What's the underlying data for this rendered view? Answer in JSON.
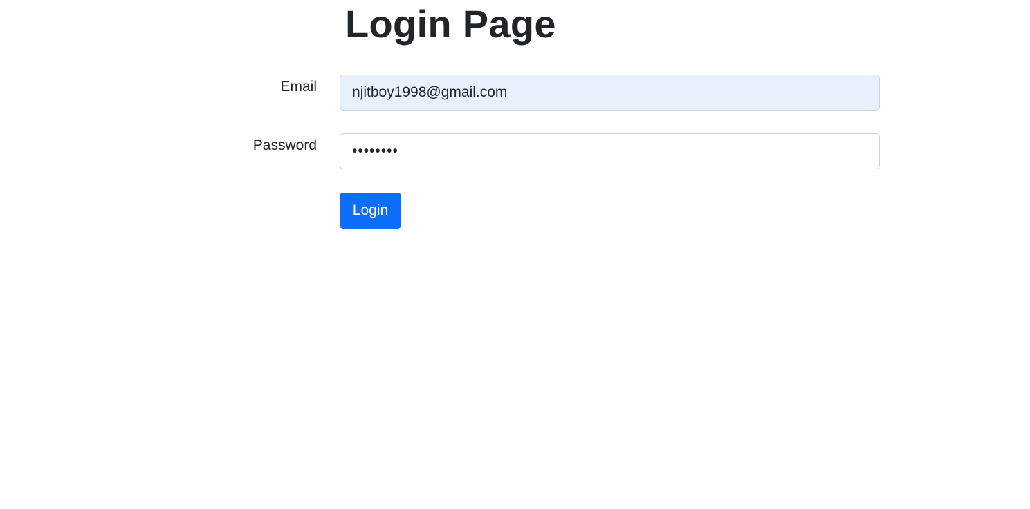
{
  "page": {
    "title": "Login Page"
  },
  "form": {
    "email_label": "Email",
    "email_value": "njitboy1998@gmail.com",
    "password_label": "Password",
    "password_value": "password",
    "submit_label": "Login"
  },
  "colors": {
    "primary": "#0d6efd",
    "autofill_background": "#e8f0fe",
    "text": "#212529",
    "border": "#ced4da"
  }
}
